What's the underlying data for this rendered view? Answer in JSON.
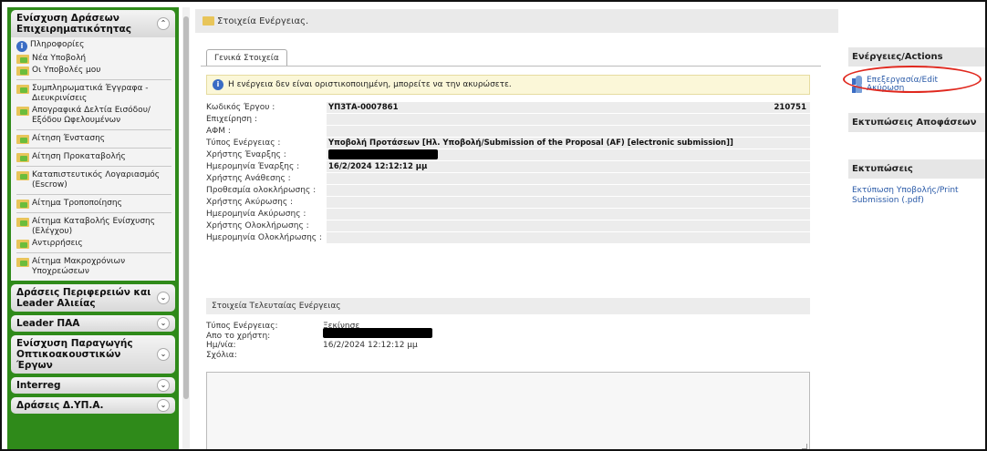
{
  "sidebar": {
    "sections": [
      {
        "title": "Ενίσχυση Δράσεων Επιχειρηματικότητας",
        "items": [
          {
            "label": "Πληροφορίες",
            "icon": "info-icon"
          },
          {
            "label": "Νέα Υποβολή",
            "icon": "folder-icon"
          },
          {
            "label": "Οι Υποβολές μου",
            "icon": "folder-icon"
          },
          {
            "label": "Συμπληρωματικά Έγγραφα - Διευκρινίσεις",
            "icon": "folder-icon"
          },
          {
            "label": "Απογραφικά Δελτία Εισόδου/ Εξόδου Ωφελουμένων",
            "icon": "folder-icon"
          },
          {
            "label": "Αίτηση Ένστασης",
            "icon": "folder-icon"
          },
          {
            "label": "Αίτηση Προκαταβολής",
            "icon": "folder-icon"
          },
          {
            "label": "Καταπιστευτικός Λογαριασμός (Escrow)",
            "icon": "folder-icon"
          },
          {
            "label": "Αίτημα Τροποποίησης",
            "icon": "folder-icon"
          },
          {
            "label": "Αίτημα Καταβολής Ενίσχυσης (Ελέγχου)",
            "icon": "folder-icon"
          },
          {
            "label": "Αντιρρήσεις",
            "icon": "folder-icon"
          },
          {
            "label": "Αίτημα Μακροχρόνιων Υποχρεώσεων",
            "icon": "folder-icon"
          }
        ]
      }
    ],
    "collapsed": [
      "Δράσεις Περιφερειών και Leader Αλιείας",
      "Leader ΠΑΑ",
      "Ενίσχυση Παραγωγής Οπτικοακουστικών Έργων",
      "Interreg",
      "Δράσεις Δ.ΥΠ.Α."
    ]
  },
  "topbar": {
    "title": "Στοιχεία Ενέργειας."
  },
  "main": {
    "tab": "Γενικά Στοιχεία",
    "notice": "Η ενέργεια δεν είναι οριστικοποιημένη, μπορείτε να την ακυρώσετε.",
    "fields": [
      {
        "label": "Κωδικός Έργου :",
        "value": "ΥΠ3ΤΑ-0007861",
        "value2": "210751"
      },
      {
        "label": "Επιχείρηση :",
        "value": ""
      },
      {
        "label": "ΑΦΜ :",
        "value": ""
      },
      {
        "label": "Τύπος Ενέργειας :",
        "value": "Υποβολή Προτάσεων [Ηλ. Υποβολή/Submission of the Proposal (AF) [electronic submission]]"
      },
      {
        "label": "Χρήστης Έναρξης :",
        "value": "",
        "redacted": true
      },
      {
        "label": "Ημερομηνία Έναρξης :",
        "value": "16/2/2024 12:12:12 μμ"
      },
      {
        "label": "Χρήστης Ανάθεσης :",
        "value": ""
      },
      {
        "label": "Προθεσμία ολοκλήρωσης :",
        "value": ""
      },
      {
        "label": "Χρήστης Ακύρωσης :",
        "value": ""
      },
      {
        "label": "Ημερομηνία Ακύρωσης :",
        "value": ""
      },
      {
        "label": "Χρήστης Ολοκλήρωσης :",
        "value": ""
      },
      {
        "label": "Ημερομηνία Ολοκλήρωσης :",
        "value": ""
      }
    ],
    "last_action": {
      "heading": "Στοιχεία Τελευταίας Ενέργειας",
      "type_label": "Τύπος Ενέργειας:",
      "type_value": "Ξεκίνησε",
      "user_label": "Απο το χρήστη:",
      "date_label": "Ημ/νία:",
      "date_value": "16/2/2024 12:12:12 μμ",
      "comments_label": "Σχόλια:"
    }
  },
  "right": {
    "actions_title": "Ενέργειες/Actions",
    "edit_label": "Επεξεργασία/Edit",
    "cancel_label": "Ακύρωση",
    "decisions_title": "Εκτυπώσεις Αποφάσεων",
    "prints_title": "Εκτυπώσεις",
    "print_link": "Εκτύπωση Υποβολής/Print Submission (.pdf)"
  },
  "colors": {
    "sidebar_green": "#2f8a1a",
    "link_blue": "#2a5aa8",
    "highlight_red": "#e0281e"
  }
}
